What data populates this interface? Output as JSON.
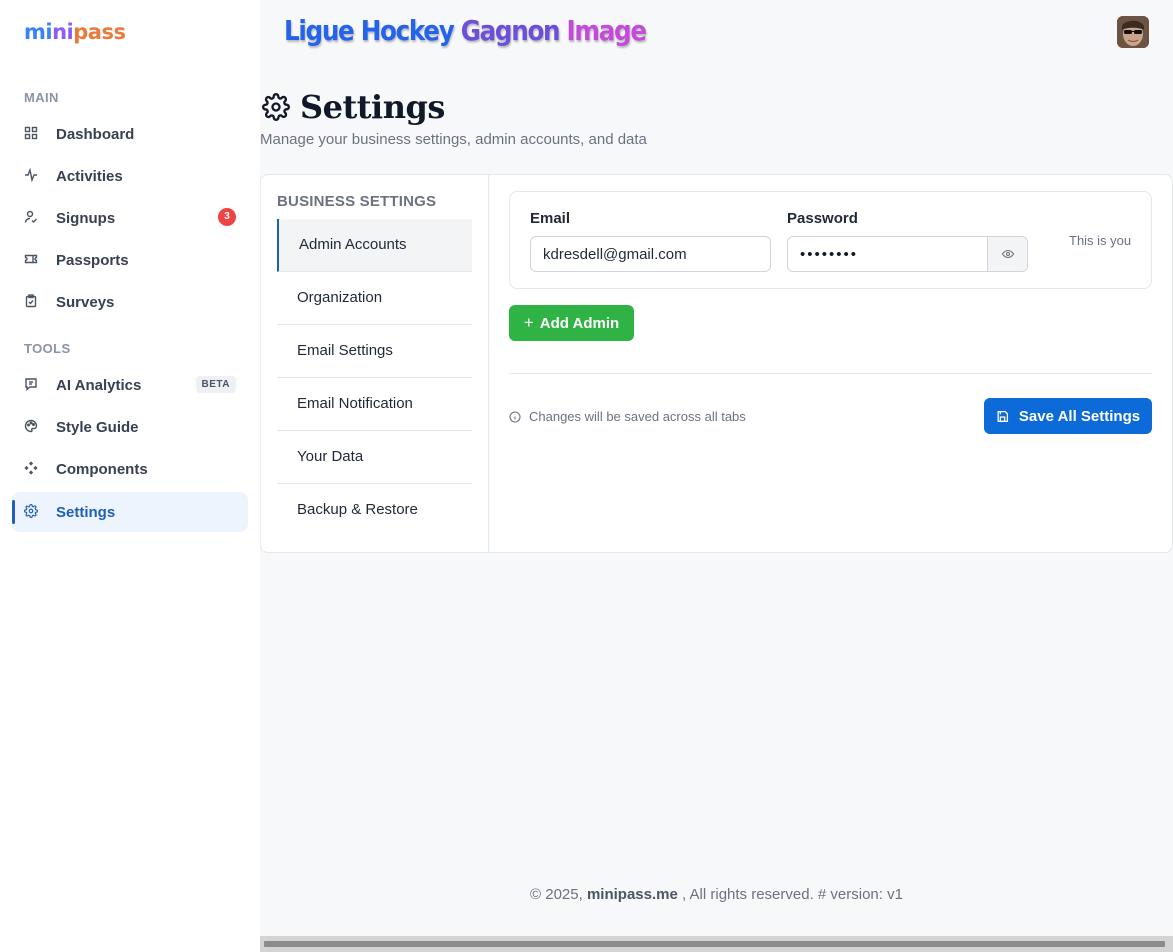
{
  "app": {
    "logo": {
      "part1": "mi",
      "part2": "ni",
      "part3": "pass"
    },
    "org_title": {
      "part1": "Ligue Hockey",
      "part2": "Gagnon",
      "part3": "Image"
    }
  },
  "sidebar": {
    "main_label": "MAIN",
    "tools_label": "TOOLS",
    "main_items": [
      {
        "label": "Dashboard",
        "icon": "dashboard-icon"
      },
      {
        "label": "Activities",
        "icon": "activity-icon"
      },
      {
        "label": "Signups",
        "icon": "signup-icon",
        "badge": "3"
      },
      {
        "label": "Passports",
        "icon": "ticket-icon"
      },
      {
        "label": "Surveys",
        "icon": "clipboard-icon"
      }
    ],
    "tool_items": [
      {
        "label": "AI Analytics",
        "icon": "chat-icon",
        "badge": "BETA"
      },
      {
        "label": "Style Guide",
        "icon": "palette-icon"
      },
      {
        "label": "Components",
        "icon": "components-icon"
      },
      {
        "label": "Settings",
        "icon": "gear-icon",
        "active": true
      }
    ]
  },
  "page": {
    "title": "Settings",
    "subtitle": "Manage your business settings, admin accounts, and data"
  },
  "settings_tabs": {
    "heading": "BUSINESS SETTINGS",
    "items": [
      {
        "label": "Admin Accounts",
        "active": true
      },
      {
        "label": "Organization"
      },
      {
        "label": "Email Settings"
      },
      {
        "label": "Email Notification"
      },
      {
        "label": "Your Data"
      },
      {
        "label": "Backup & Restore"
      }
    ]
  },
  "admin": {
    "email_label": "Email",
    "password_label": "Password",
    "email_value": "kdresdell@gmail.com",
    "password_value": "••••••••",
    "self_note": "This is you",
    "add_button": "Add Admin",
    "add_icon": "+",
    "save_note": "Changes will be saved across all tabs",
    "save_button": "Save All Settings"
  },
  "footer": {
    "prefix": "© 2025,",
    "brand": "minipass.me",
    "suffix": ", All rights reserved. # version: v1"
  },
  "colors": {
    "accent": "#0c6ad9",
    "success": "#2fb344",
    "danger": "#ef4444",
    "active_nav": "#1e5fb8"
  }
}
